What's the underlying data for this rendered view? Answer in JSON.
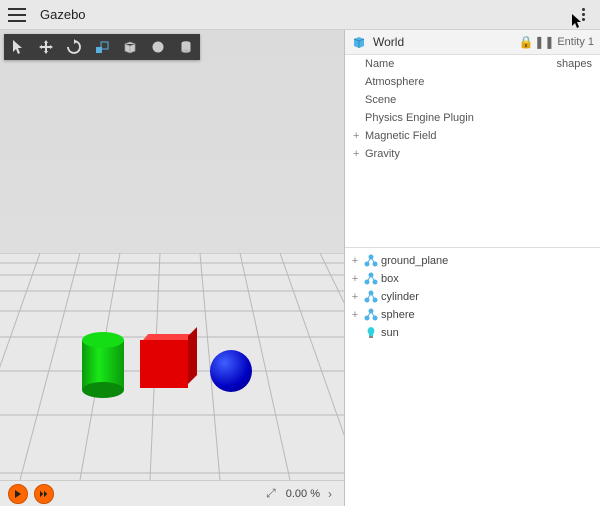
{
  "app": {
    "title": "Gazebo"
  },
  "toolbar": {
    "tools": [
      "select",
      "translate",
      "rotate",
      "scale",
      "box",
      "sphere",
      "cylinder"
    ]
  },
  "playback": {
    "percent": "0.00 %"
  },
  "world": {
    "header_label": "World",
    "entity_label": "Entity 1",
    "value": "shapes",
    "props": [
      {
        "key": "Name",
        "value": "shapes",
        "expandable": false,
        "indent": true
      },
      {
        "key": "Atmosphere",
        "value": "",
        "expandable": false,
        "indent": true
      },
      {
        "key": "Scene",
        "value": "",
        "expandable": false,
        "indent": true
      },
      {
        "key": "Physics Engine Plugin",
        "value": "",
        "expandable": false,
        "indent": true
      },
      {
        "key": "Magnetic Field",
        "value": "",
        "expandable": true,
        "indent": false
      },
      {
        "key": "Gravity",
        "value": "",
        "expandable": true,
        "indent": false
      }
    ]
  },
  "tree": [
    {
      "label": "ground_plane",
      "icon": "model",
      "expandable": true
    },
    {
      "label": "box",
      "icon": "model",
      "expandable": true
    },
    {
      "label": "cylinder",
      "icon": "model",
      "expandable": true
    },
    {
      "label": "sphere",
      "icon": "model",
      "expandable": true
    },
    {
      "label": "sun",
      "icon": "light",
      "expandable": false
    }
  ]
}
